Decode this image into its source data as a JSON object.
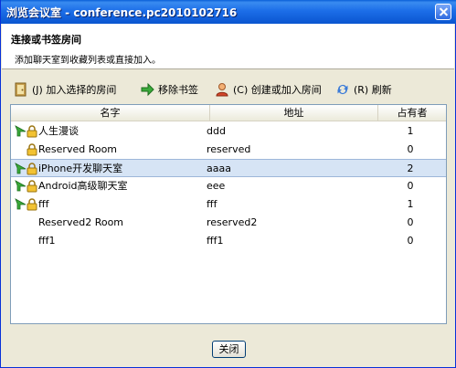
{
  "window": {
    "title": "浏览会议室 - conference.pc2010102716"
  },
  "header": {
    "title": "连接或书签房间",
    "description": "添加聊天室到收藏列表或直接加入。"
  },
  "toolbar": {
    "join_label": "(J) 加入选择的房间",
    "remove_bookmark_label": "移除书签",
    "create_label": "(C) 创建或加入房间",
    "refresh_label": "(R) 刷新"
  },
  "table": {
    "columns": [
      "名字",
      "地址",
      "占有者"
    ],
    "rows": [
      {
        "name": "人生漫谈",
        "address": "ddd",
        "occupants": "1",
        "bookmarked": true,
        "locked": true
      },
      {
        "name": "Reserved Room",
        "address": "reserved",
        "occupants": "0",
        "bookmarked": false,
        "locked": true
      },
      {
        "name": "iPhone开发聊天室",
        "address": "aaaa",
        "occupants": "2",
        "bookmarked": true,
        "locked": true,
        "selected": true
      },
      {
        "name": "Android高级聊天室",
        "address": "eee",
        "occupants": "0",
        "bookmarked": true,
        "locked": true
      },
      {
        "name": "fff",
        "address": "fff",
        "occupants": "1",
        "bookmarked": true,
        "locked": true
      },
      {
        "name": "Reserved2 Room",
        "address": "reserved2",
        "occupants": "0",
        "bookmarked": false,
        "locked": false
      },
      {
        "name": "fff1",
        "address": "fff1",
        "occupants": "0",
        "bookmarked": false,
        "locked": false
      }
    ]
  },
  "footer": {
    "close_label": "关闭"
  },
  "colors": {
    "title_bar": "#0A55D0",
    "selected_row": "#D6E4F5",
    "dialog_bg": "#ECE9D8"
  }
}
